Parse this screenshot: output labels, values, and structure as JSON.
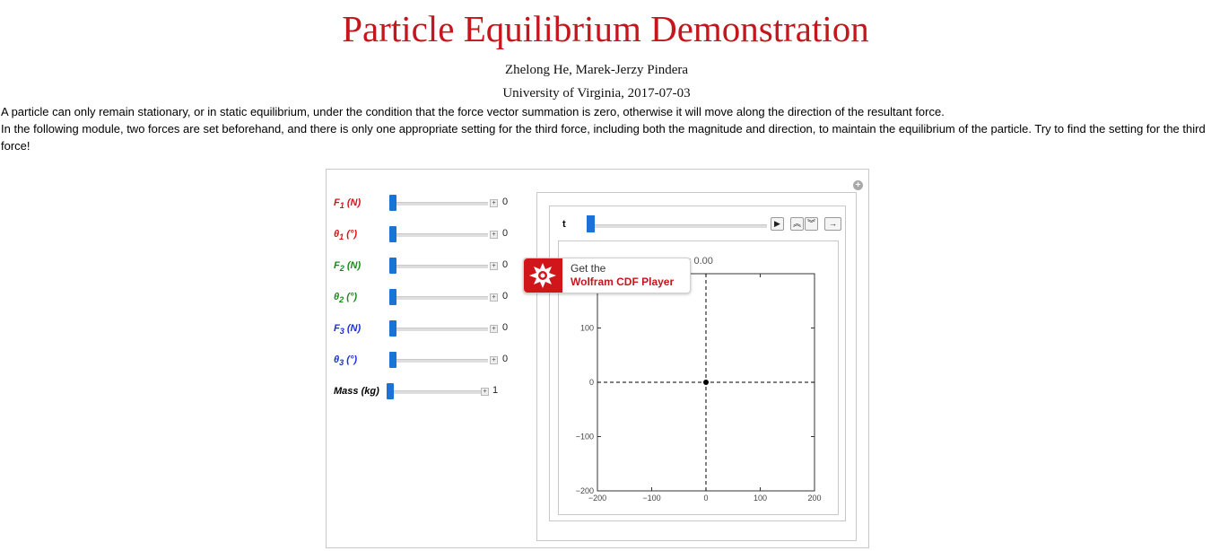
{
  "page": {
    "title": "Particle Equilibrium Demonstration",
    "authors": "Zhelong He, Marek-Jerzy Pindera",
    "affiliation": "University of Virginia, 2017-07-03",
    "intro": [
      "A particle can only remain stationary, or in static equilibrium, under the condition that the force vector summation is zero, otherwise it will move along the direction of the resultant force.",
      "In the following module, two forces are set beforehand, and there is only one appropriate setting for the third force, including both the magnitude and direction, to maintain the equilibrium of the particle. Try to find the setting for the third force!"
    ]
  },
  "controls": {
    "f1": {
      "label": "F1 (N)",
      "sym": "F",
      "sub": "1",
      "unit": " (N)",
      "value": "0",
      "color": "#d4161c"
    },
    "theta1": {
      "label": "θ1 (°)",
      "sym": "θ",
      "sub": "1",
      "unit": " (°)",
      "value": "0",
      "color": "#d4161c"
    },
    "f2": {
      "label": "F2 (N)",
      "sym": "F",
      "sub": "2",
      "unit": " (N)",
      "value": "0",
      "color": "#1a8a1a"
    },
    "theta2": {
      "label": "θ2 (°)",
      "sym": "θ",
      "sub": "2",
      "unit": " (°)",
      "value": "0",
      "color": "#1a8a1a"
    },
    "f3": {
      "label": "F3 (N)",
      "sym": "F",
      "sub": "3",
      "unit": " (N)",
      "value": "0",
      "color": "#1a2fd4"
    },
    "theta3": {
      "label": "θ3 (°)",
      "sym": "θ",
      "sub": "3",
      "unit": " (°)",
      "value": "0",
      "color": "#1a2fd4"
    },
    "mass": {
      "label": "Mass (kg)",
      "value": "1",
      "color": "#000000"
    }
  },
  "animator": {
    "label": "t",
    "time_readout": "= 0.00",
    "buttons": [
      "play",
      "faster",
      "slower",
      "direction"
    ]
  },
  "plot": {
    "x_ticks": [
      "−200",
      "−100",
      "0",
      "100",
      "200"
    ],
    "y_ticks": [
      "100",
      "0",
      "−100",
      "−200"
    ],
    "xlim": [
      -200,
      200
    ],
    "ylim": [
      -200,
      200
    ],
    "particle": {
      "x": 0,
      "y": 0
    }
  },
  "cdf_badge": {
    "line1": "Get the",
    "line2": "Wolfram CDF Player",
    "color": "#d1161b"
  }
}
